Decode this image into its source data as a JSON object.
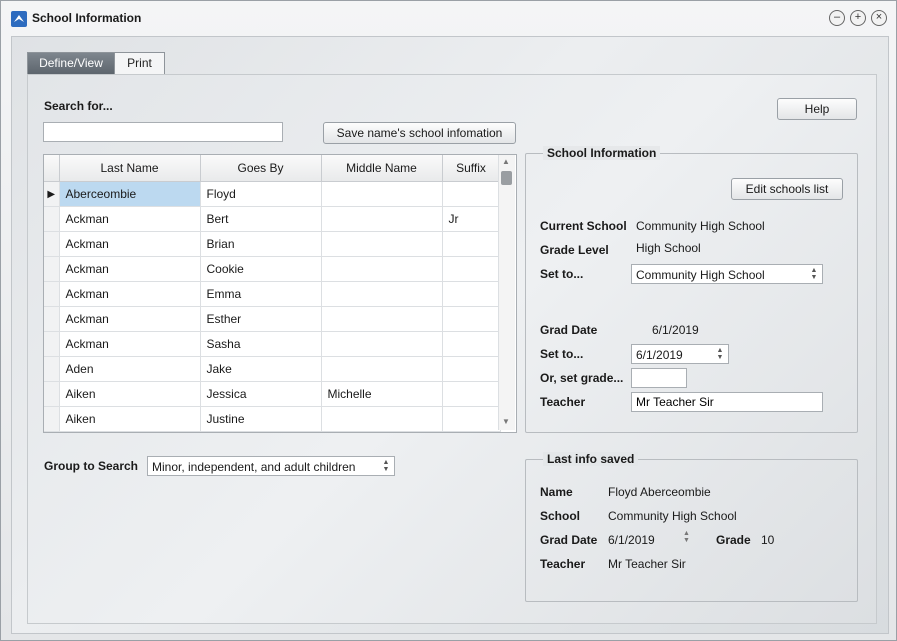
{
  "window": {
    "title": "School Information",
    "controls": [
      "–",
      "+",
      "×"
    ]
  },
  "tabs": [
    {
      "label": "Define/View"
    },
    {
      "label": "Print"
    }
  ],
  "search": {
    "label": "Search for...",
    "value": "",
    "save_button": "Save name's school infomation"
  },
  "help_button": "Help",
  "grid": {
    "columns": [
      "Last Name",
      "Goes By",
      "Middle Name",
      "Suffix"
    ],
    "rows": [
      {
        "last": "Aberceombie",
        "goes_by": "Floyd",
        "middle": "",
        "suffix": ""
      },
      {
        "last": "Ackman",
        "goes_by": "Bert",
        "middle": "",
        "suffix": "Jr"
      },
      {
        "last": "Ackman",
        "goes_by": "Brian",
        "middle": "",
        "suffix": ""
      },
      {
        "last": "Ackman",
        "goes_by": "Cookie",
        "middle": "",
        "suffix": ""
      },
      {
        "last": "Ackman",
        "goes_by": "Emma",
        "middle": "",
        "suffix": ""
      },
      {
        "last": "Ackman",
        "goes_by": "Esther",
        "middle": "",
        "suffix": ""
      },
      {
        "last": "Ackman",
        "goes_by": "Sasha",
        "middle": "",
        "suffix": ""
      },
      {
        "last": "Aden",
        "goes_by": "Jake",
        "middle": "",
        "suffix": ""
      },
      {
        "last": "Aiken",
        "goes_by": "Jessica",
        "middle": "Michelle",
        "suffix": ""
      },
      {
        "last": "Aiken",
        "goes_by": "Justine",
        "middle": "",
        "suffix": ""
      }
    ],
    "selected_marker": "▶"
  },
  "group_search": {
    "label": "Group to Search",
    "value": "Minor, independent, and adult children"
  },
  "school_info": {
    "title": "School Information",
    "edit_button": "Edit schools list",
    "current_school_label": "Current School",
    "current_school": "Community High School",
    "grade_level_label": "Grade Level",
    "grade_level": "High School",
    "set_to_label": "Set to...",
    "set_to_value": "Community High School",
    "grad_date_label": "Grad Date",
    "grad_date": "6/1/2019",
    "set_date_label": "Set to...",
    "set_date_value": "6/1/2019",
    "or_grade_label": "Or, set grade...",
    "or_grade_value": "",
    "teacher_label": "Teacher",
    "teacher_value": "Mr Teacher Sir"
  },
  "last_saved": {
    "title": "Last info saved",
    "name_label": "Name",
    "name": "Floyd Aberceombie",
    "school_label": "School",
    "school": "Community High School",
    "grad_date_label": "Grad Date",
    "grad_date": "6/1/2019",
    "grade_label": "Grade",
    "grade": "10",
    "teacher_label": "Teacher",
    "teacher": "Mr Teacher Sir"
  }
}
